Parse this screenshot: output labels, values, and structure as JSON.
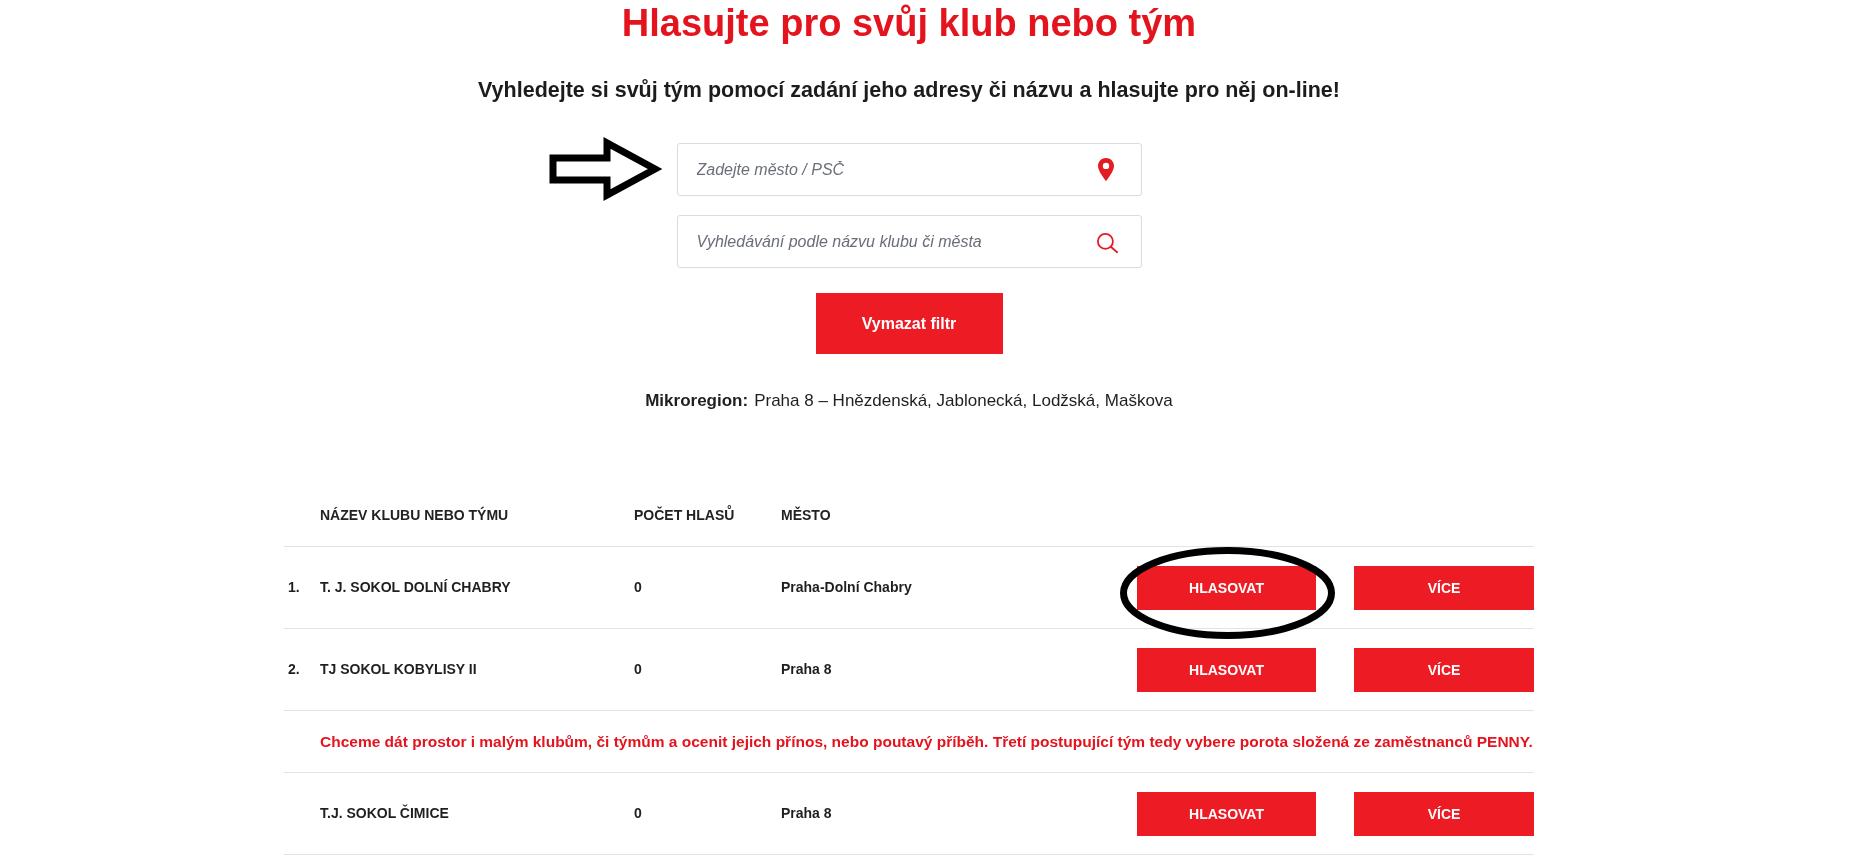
{
  "heading": {
    "title": "Hlasujte pro svůj klub nebo tým",
    "subtitle": "Vyhledejte si svůj tým pomocí zadání jeho adresy či názvu a hlasujte pro něj on-line!"
  },
  "search": {
    "location_field": {
      "placeholder": "Zadejte město / PSČ",
      "arrow_marker": true
    },
    "name_field": {
      "placeholder": "Vyhledávání podle názvu klubu či města",
      "arrow_marker": false
    },
    "clear_button": "Vymazat filtr"
  },
  "microregion": {
    "label": "Mikroregion:",
    "value": "Praha 8 – Hnězdenská, Jablonecká, Lodžská, Maškova"
  },
  "table": {
    "columns": [
      "NÁZEV KLUBU NEBO TÝMU",
      "POČET HLASŮ",
      "MĚSTO"
    ],
    "rows": [
      {
        "kind": "team",
        "rank": "1.",
        "name": "T. J. SOKOL DOLNÍ CHABRY",
        "votes": "0",
        "city": "Praha-Dolní Chabry",
        "vote_button": "HLASOVAT",
        "more_button": "VÍCE",
        "circled": true
      },
      {
        "kind": "team",
        "rank": "2.",
        "name": "TJ SOKOL KOBYLISY II",
        "votes": "0",
        "city": "Praha 8",
        "vote_button": "HLASOVAT",
        "more_button": "VÍCE",
        "circled": false
      },
      {
        "kind": "note",
        "text": "Chceme dát prostor i malým klubům, či týmům a ocenit jejich přínos, nebo poutavý příběh. Třetí postupující tým tedy vybere porota složená ze zaměstnanců PENNY."
      },
      {
        "kind": "team",
        "name": "T.J. SOKOL ČIMICE",
        "votes": "0",
        "city": "Praha 8",
        "vote_button": "HLASOVAT",
        "more_button": "VÍCE",
        "circled": false
      }
    ]
  }
}
